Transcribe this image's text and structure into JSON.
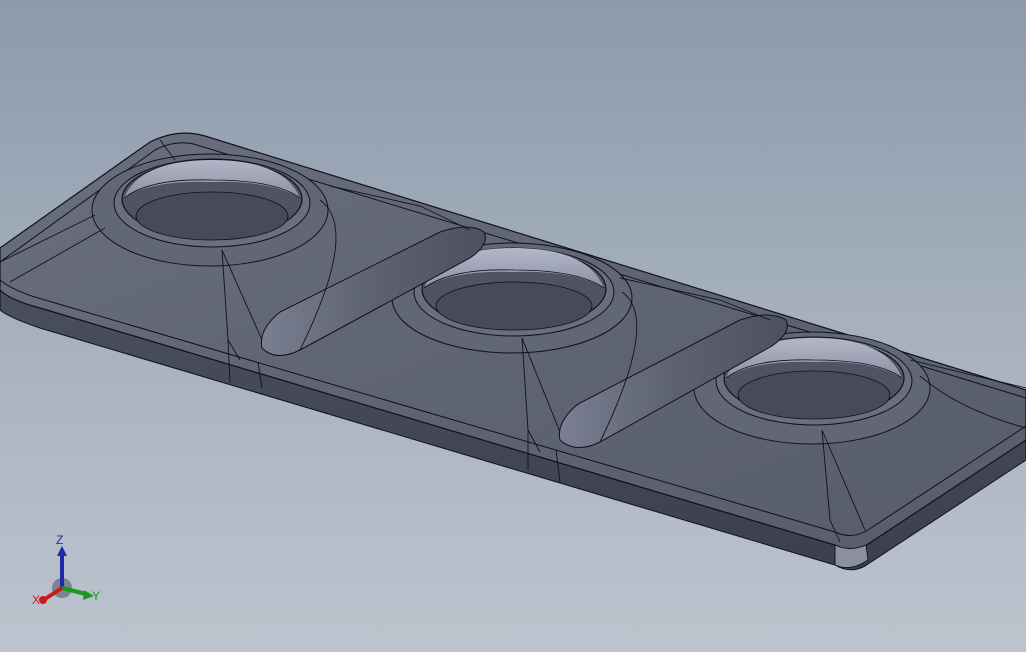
{
  "viewport": {
    "background_top": "#8d9aab",
    "background_bottom": "#bcc4ce",
    "model_color": "#5c6170",
    "edge_color": "#101218",
    "hole_wall_color": "#a3a8ba"
  },
  "triad": {
    "x_label": "X",
    "y_label": "Y",
    "z_label": "Z",
    "x_color": "#d01818",
    "y_color": "#1a9a1a",
    "z_color": "#1c2aa8"
  }
}
